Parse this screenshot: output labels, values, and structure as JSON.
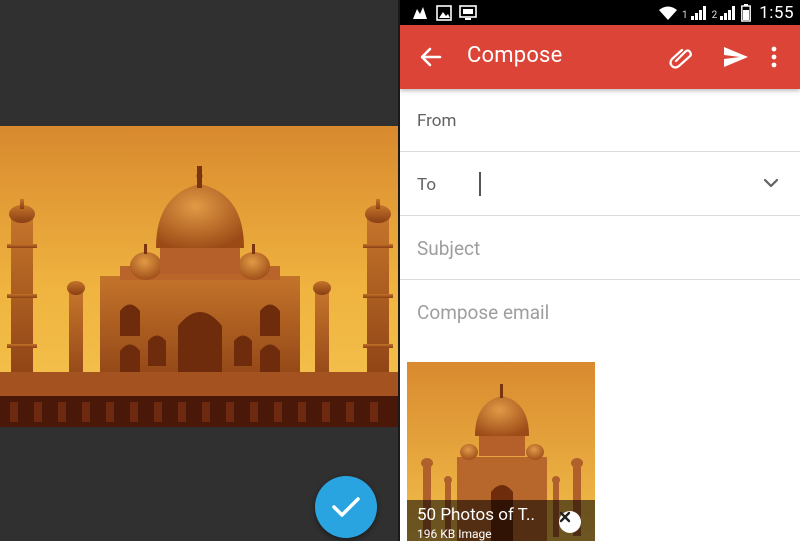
{
  "status_bar": {
    "sim1": "1",
    "sim2": "2",
    "time": "1:55",
    "icons": [
      "notification-app-icon",
      "gallery-notification-icon",
      "screenshot-notification-icon",
      "wifi-icon",
      "signal-icon",
      "signal-icon",
      "battery-icon"
    ]
  },
  "app_bar": {
    "title": "Compose",
    "icons": [
      "back-arrow-icon",
      "paperclip-icon",
      "send-icon",
      "more-vert-icon"
    ]
  },
  "compose": {
    "from_label": "From",
    "to_label": "To",
    "subject_placeholder": "Subject",
    "body_placeholder": "Compose email"
  },
  "attachment": {
    "name": "50 Photos of T..",
    "meta": "196 KB Image"
  },
  "viewer": {
    "confirm_icon": "checkmark-icon"
  },
  "colors": {
    "app_bar": "#db4437",
    "fab": "#2aa4e0",
    "viewer_bg": "#303030",
    "sky_top": "#e8a33c",
    "sky_bottom": "#f0b845"
  }
}
